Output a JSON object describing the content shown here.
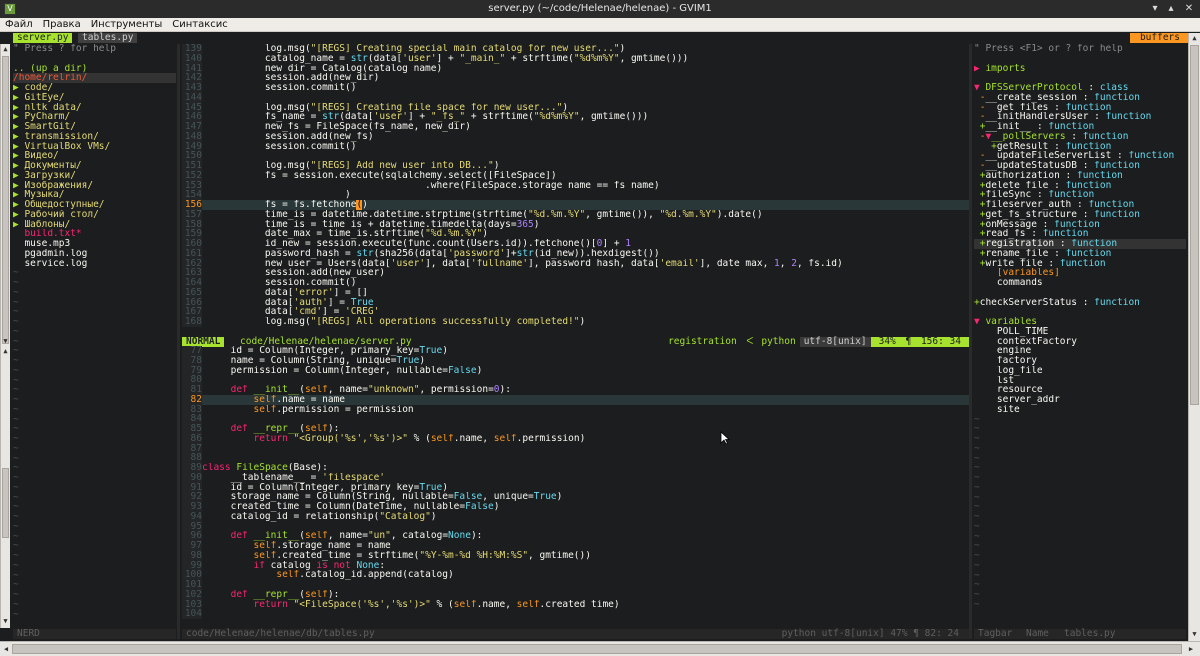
{
  "window": {
    "title": "server.py (~/code/Helenae/helenae) - GVIM1"
  },
  "menu": [
    "Файл",
    "Правка",
    "Инструменты",
    "Синтаксис"
  ],
  "tabs": [
    {
      "label": "server.py",
      "active": true
    },
    {
      "label": "tables.py",
      "active": false
    }
  ],
  "buffers_label": "buffers",
  "nerdtree": {
    "help": "\" Press ? for help",
    "updir": ".. (up a dir)",
    "root": "/home/relrin/",
    "dirs": [
      "code/",
      "GitEye/",
      "nltk_data/",
      "PyCharm/",
      "SmartGit/",
      "transmission/",
      "VirtualBox VMs/",
      "Видео/",
      "Документы/",
      "Загрузки/",
      "Изображения/",
      "Музыка/",
      "Общедоступные/",
      "Рабочий стол/",
      "Шаблоны/"
    ],
    "files": [
      {
        "name": "build.txt*",
        "modified": true
      },
      {
        "name": "muse.mp3",
        "modified": false
      },
      {
        "name": "pgadmin.log",
        "modified": false
      },
      {
        "name": "service.log",
        "modified": false
      }
    ],
    "status": "NERD"
  },
  "top_window": {
    "status": {
      "mode": "NORMAL",
      "path": "code/Helenae/helenae/server.py",
      "function": "registration",
      "filetype": "python",
      "encoding": "utf-8[unix]",
      "position": "34%",
      "line_col": "156: 34"
    }
  },
  "bottom_window": {
    "status": {
      "path": "code/Helenae/helenae/db/tables.py",
      "filetype": "python",
      "encoding": "utf-8[unix]",
      "position": "47%",
      "line_col": "82: 24"
    }
  },
  "tagbar": {
    "help": "\" Press <F1> or ? for help",
    "imports": "imports",
    "class_name": "DFSServerProtocol",
    "class_kind": "class",
    "members": [
      {
        "vis": "-",
        "name": "__create_session",
        "kind": "function",
        "indent": 1
      },
      {
        "vis": "-",
        "name": "__get_files",
        "kind": "function",
        "indent": 1
      },
      {
        "vis": "-",
        "name": "__initHandlersUser",
        "kind": "function",
        "indent": 1
      },
      {
        "vis": "+",
        "name": "__init__",
        "kind": "function",
        "indent": 1
      },
      {
        "vis": "-",
        "name": "__pollServers",
        "kind": "function",
        "indent": 1,
        "folded_open": true
      },
      {
        "vis": "+",
        "name": "getResult",
        "kind": "function",
        "indent": 2
      },
      {
        "vis": "-",
        "name": "__updateFileServerList",
        "kind": "function",
        "indent": 1
      },
      {
        "vis": "-",
        "name": "__updateStatusDB",
        "kind": "function",
        "indent": 1
      },
      {
        "vis": "+",
        "name": "authorization",
        "kind": "function",
        "indent": 1
      },
      {
        "vis": "+",
        "name": "delete_file",
        "kind": "function",
        "indent": 1
      },
      {
        "vis": "+",
        "name": "fileSync",
        "kind": "function",
        "indent": 1
      },
      {
        "vis": "+",
        "name": "fileserver_auth",
        "kind": "function",
        "indent": 1
      },
      {
        "vis": "+",
        "name": "get_fs_structure",
        "kind": "function",
        "indent": 1
      },
      {
        "vis": "+",
        "name": "onMessage",
        "kind": "function",
        "indent": 1
      },
      {
        "vis": "+",
        "name": "read_fs",
        "kind": "function",
        "indent": 1
      },
      {
        "vis": "+",
        "name": "registration",
        "kind": "function",
        "indent": 1,
        "selected": true
      },
      {
        "vis": "+",
        "name": "rename_file",
        "kind": "function",
        "indent": 1
      },
      {
        "vis": "+",
        "name": "write_file",
        "kind": "function",
        "indent": 1
      }
    ],
    "variables_label": "[variables]",
    "commands": "commands",
    "check_server": {
      "vis": "+",
      "name": "checkServerStatus",
      "kind": "function"
    },
    "variables_header": "variables",
    "variables": [
      "POLL_TIME",
      "contextFactory",
      "engine",
      "factory",
      "log_file",
      "lst",
      "resource",
      "server_addr",
      "site"
    ],
    "status": {
      "name": "Tagbar",
      "label": "Name",
      "file": "tables.py"
    }
  }
}
